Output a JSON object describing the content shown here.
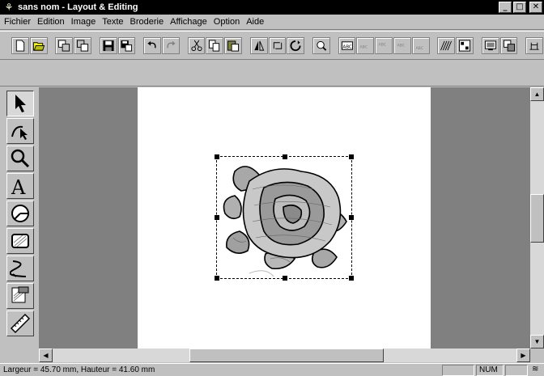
{
  "window": {
    "title": "sans nom - Layout & Editing",
    "minimize": "_",
    "maximize": "□",
    "close": "✕"
  },
  "menu": [
    "Fichier",
    "Edition",
    "Image",
    "Texte",
    "Broderie",
    "Affichage",
    "Option",
    "Aide"
  ],
  "toolbar": {
    "buttons": [
      "new-icon",
      "open-icon",
      "sep",
      "import-icon",
      "import-image-icon",
      "sep",
      "save-icon",
      "save-as-icon",
      "sep",
      "undo-icon",
      "redo-icon",
      "sep",
      "cut-icon",
      "copy-icon",
      "paste-icon",
      "sep",
      "mirror-icon",
      "rotate-icon",
      "rotate-free-icon",
      "sep",
      "zoom-icon",
      "sep",
      "text-abc-icon",
      "text-arc-icon",
      "text-vertical-icon",
      "text-skew-icon",
      "text-baseline-icon",
      "sep",
      "stitch-pattern-icon",
      "stitch-area-icon",
      "sep",
      "monitor-icon",
      "transfer-icon",
      "sep",
      "hoop-icon"
    ]
  },
  "tools": [
    "arrow-tool-icon",
    "point-edit-icon",
    "zoom-tool-icon",
    "text-tool-icon",
    "shape-tool-icon",
    "rectangle-tool-icon",
    "line-tool-icon",
    "embroidery-tool-icon",
    "ruler-tool-icon"
  ],
  "status": {
    "text": "Largeur = 45.70 mm, Hauteur = 41.60 mm",
    "num": "NUM"
  }
}
